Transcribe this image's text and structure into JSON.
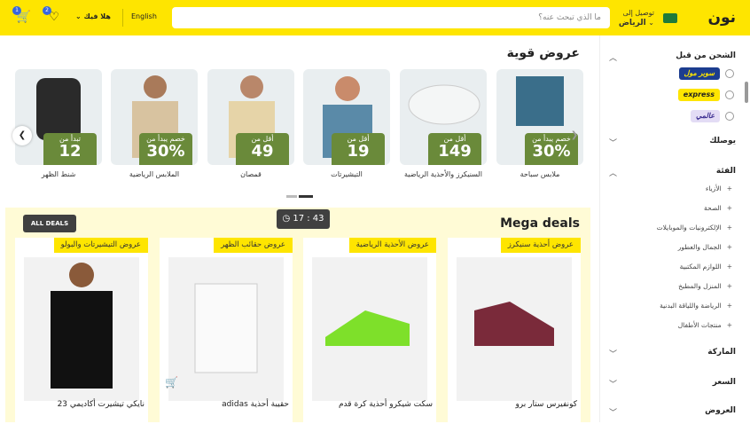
{
  "header": {
    "logo": "نون",
    "deliver_label": "توصيل إلى",
    "city": "الرياض",
    "search_placeholder": "ما الذي تبحث عنه؟",
    "lang": "English",
    "hello": "هلا فيك",
    "wishlist_count": "2",
    "cart_count": "1"
  },
  "sidebar": {
    "shipping_title": "الشحن من قبل",
    "options": [
      "سوبر مول",
      "express",
      "عالمي"
    ],
    "deliver_title": "يوصلك",
    "category_title": "الفئة",
    "categories": [
      "الأزياء",
      "الصحة",
      "الإلكترونيات والموبايلات",
      "الجمال والعطور",
      "اللوازم المكتبية",
      "المنزل والمطبخ",
      "الرياضة واللياقة البدنية",
      "منتجات الأطفال"
    ],
    "brand_title": "الماركة",
    "price_title": "السعر",
    "deals_title": "العروض"
  },
  "offers": {
    "title": "عروض قوية",
    "items": [
      {
        "tag_a": "خصم يبدأ من",
        "tag_b": "30%",
        "label": "ملابس سباحة"
      },
      {
        "tag_a": "أقل من",
        "tag_b": "149",
        "label": "السنيكرز والأحذية الرياضية"
      },
      {
        "tag_a": "أقل من",
        "tag_b": "19",
        "label": "التيشيرتات"
      },
      {
        "tag_a": "أقل من",
        "tag_b": "49",
        "label": "قمصان"
      },
      {
        "tag_a": "خصم يبدأ من",
        "tag_b": "30%",
        "label": "الملابس الرياضية"
      },
      {
        "tag_a": "تبدأ من",
        "tag_b": "12",
        "label": "شنط الظهر"
      }
    ]
  },
  "mega": {
    "title": "Mega deals",
    "timer": "17 : 43",
    "all_deals": "ALL DEALS",
    "deals": [
      {
        "tag": "عروض أحذية سنيكرز",
        "name": "كونفيرس ستار برو"
      },
      {
        "tag": "عروض الأحذية الرياضية",
        "name": "سكت شيكرو أحذية كرة قدم"
      },
      {
        "tag": "عروض حقائب الظهر",
        "name": "adidas حقيبة أحذية"
      },
      {
        "tag": "عروض التيشيرتات والبولو",
        "name": "نايكي تيشيرت أكاديمي 23"
      }
    ]
  },
  "colors": {
    "brand_yellow": "#fee500",
    "tag_green": "#6a8a3a",
    "badge_blue": "#3866df"
  }
}
